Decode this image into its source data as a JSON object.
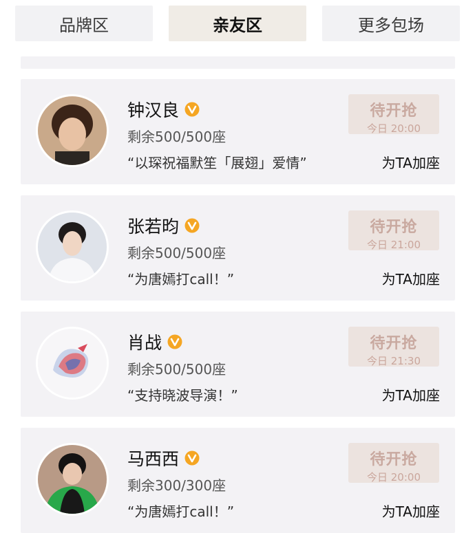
{
  "tabs": [
    {
      "label": "品牌区",
      "active": false
    },
    {
      "label": "亲友区",
      "active": true
    },
    {
      "label": "更多包场",
      "active": false
    }
  ],
  "colors": {
    "verified_badge": "#f5a623",
    "button_bg": "#ece3df",
    "button_text": "#c9a9a0"
  },
  "cards": [
    {
      "name": "钟汉良",
      "verified_icon": "verified-v-badge-icon",
      "seats": "剩余500/500座",
      "quote": "“以琛祝福默笙「展翅」爱情”",
      "button_title": "待开抢",
      "button_time": "今日 20:00",
      "add_label": "为TA加座"
    },
    {
      "name": "张若昀",
      "verified_icon": "verified-v-badge-icon",
      "seats": "剩余500/500座",
      "quote": "“为唐嫣打call！”",
      "button_title": "待开抢",
      "button_time": "今日 21:00",
      "add_label": "为TA加座"
    },
    {
      "name": "肖战",
      "verified_icon": "verified-v-badge-icon",
      "seats": "剩余500/500座",
      "quote": "“支持晓波导演！”",
      "button_title": "待开抢",
      "button_time": "今日 21:30",
      "add_label": "为TA加座"
    },
    {
      "name": "马西西",
      "verified_icon": "verified-v-badge-icon",
      "seats": "剩余300/300座",
      "quote": "“为唐嫣打call！”",
      "button_title": "待开抢",
      "button_time": "今日 20:00",
      "add_label": "为TA加座"
    }
  ]
}
